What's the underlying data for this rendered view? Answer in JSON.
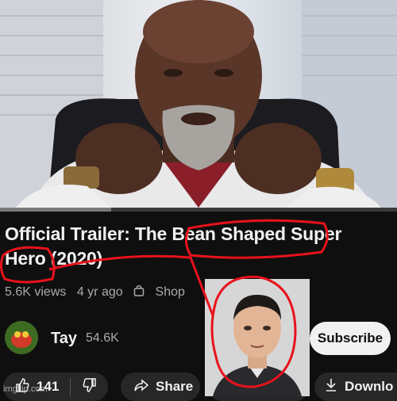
{
  "video": {
    "title_part1": "Official Trailer: The ",
    "title_highlight": "Bean Shaped",
    "title_part2": " Super",
    "title_line2_highlight": "Hero",
    "title_line2_rest": " (2020)",
    "views": "5.6K views",
    "age": "4 yr ago",
    "shop_label": "Shop",
    "progress_fraction": 0.28
  },
  "channel": {
    "name": "Tay",
    "subscribers": "54.6K",
    "subscribe_label": "Subscribe"
  },
  "actions": {
    "likes": "141",
    "share_label": "Share",
    "download_label": "Downlo"
  },
  "watermark": "imgflip.com",
  "colors": {
    "background": "#0f0f0f",
    "annotation_red": "#e8121c",
    "subscribe_bg": "#f1f1f1",
    "chip_bg": "#272727"
  },
  "icons": [
    "shopping-bag-icon",
    "like-icon",
    "dislike-icon",
    "share-icon",
    "download-icon"
  ]
}
